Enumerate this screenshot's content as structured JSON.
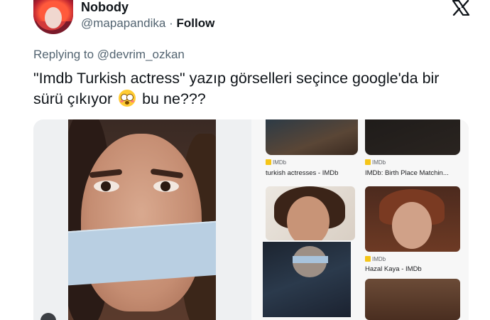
{
  "author": {
    "display_name": "Nobody",
    "handle": "@mapapandika",
    "separator": "·",
    "follow_label": "Follow"
  },
  "reply": {
    "prefix": "Replying to",
    "mention": "@devrim_ozkan"
  },
  "tweet": {
    "text_before_emoji": "\"Imdb Turkish actress\" yazıp görselleri seçince google'da bir sürü çıkıyor",
    "emoji": "flushed-face",
    "text_after_emoji": "bu ne???"
  },
  "image_results": [
    {
      "source": "IMDb",
      "caption": "turkish actresses - IMDb"
    },
    {
      "source": "IMDb",
      "caption": "IMDb: Birth Place Matchin..."
    },
    {
      "source": "IMDb",
      "caption": "Hazal Kaya - IMDb"
    }
  ],
  "colors": {
    "text_primary": "#0f1419",
    "text_secondary": "#536471",
    "imdb_yellow": "#f5c518"
  }
}
